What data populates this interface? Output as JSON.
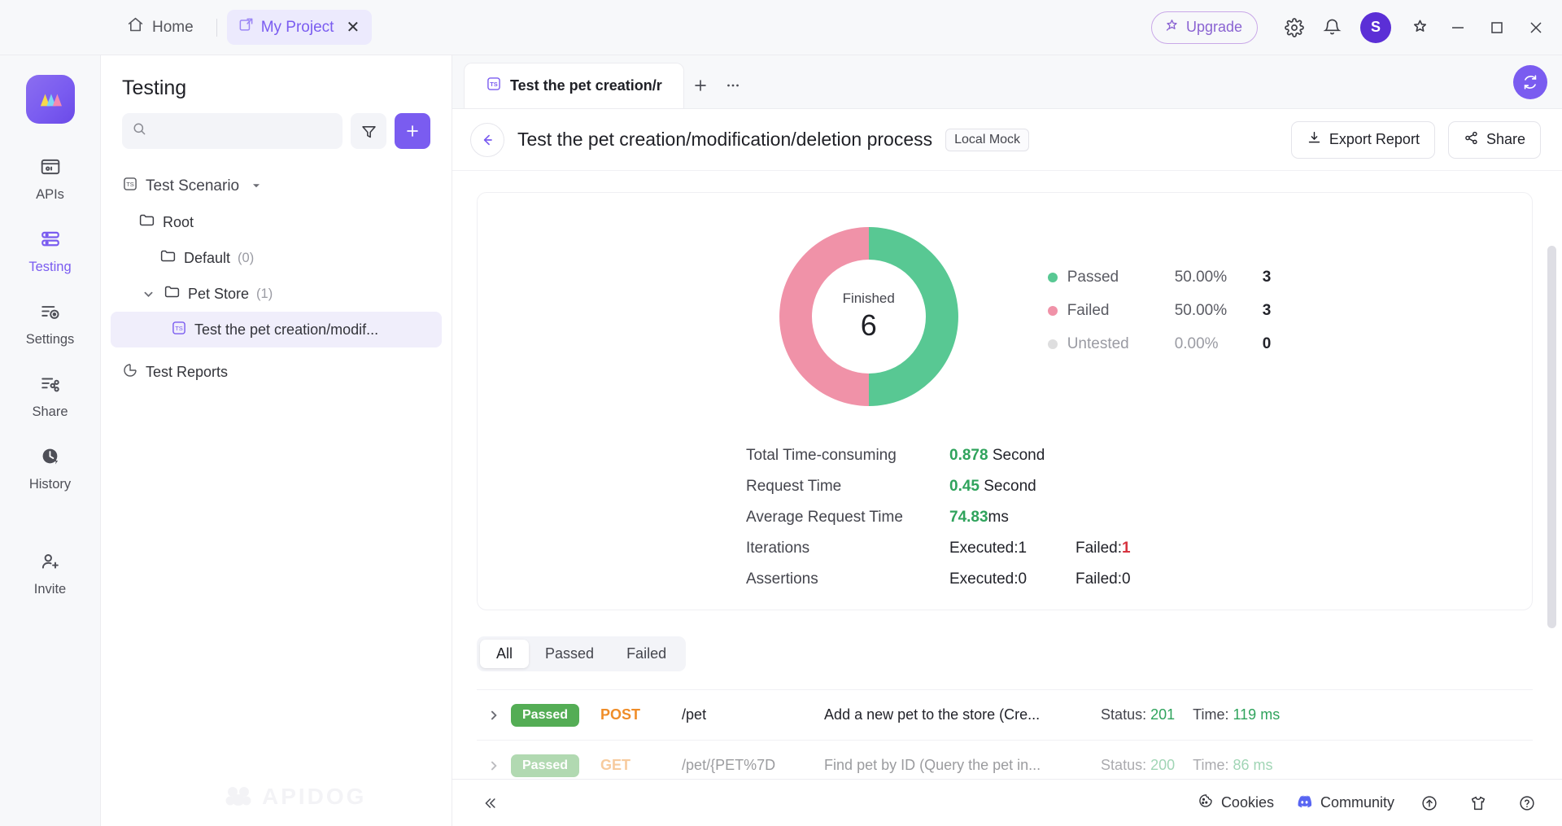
{
  "titlebar": {
    "home_label": "Home",
    "project_tab_label": "My Project",
    "project_tab_close": "✕",
    "upgrade_label": "Upgrade",
    "avatar_initial": "S"
  },
  "rail": {
    "items": [
      {
        "label": "APIs",
        "icon": "apis-icon"
      },
      {
        "label": "Testing",
        "icon": "testing-icon"
      },
      {
        "label": "Settings",
        "icon": "settings-icon"
      },
      {
        "label": "Share",
        "icon": "share-icon"
      },
      {
        "label": "History",
        "icon": "history-icon"
      },
      {
        "label": "Invite",
        "icon": "invite-icon"
      }
    ]
  },
  "tree": {
    "title": "Testing",
    "search_placeholder": "",
    "search_value": "",
    "scenario_label": "Test Scenario",
    "nodes": [
      {
        "label": "Root",
        "count": ""
      },
      {
        "label": "Default",
        "count": "(0)"
      },
      {
        "label": "Pet Store",
        "count": "(1)"
      },
      {
        "label": "Test the pet creation/modif..."
      }
    ],
    "reports_label": "Test Reports",
    "watermark": "APIDOG"
  },
  "main": {
    "file_tab_label": "Test the pet creation/r",
    "subtitle": "Test the pet creation/modification/deletion process",
    "mock_badge": "Local Mock",
    "export_label": "Export Report",
    "share_label": "Share"
  },
  "chart_data": {
    "type": "pie",
    "title": "Finished",
    "center_label": "Finished",
    "center_value": "6",
    "total": 6,
    "categories": [
      "Passed",
      "Failed",
      "Untested"
    ],
    "values": [
      3,
      3,
      0
    ],
    "percents": [
      "50.00%",
      "50.00%",
      "0.00%"
    ],
    "counts": [
      "3",
      "3",
      "0"
    ],
    "colors": [
      "#58c893",
      "#f092a8",
      "#dededf"
    ],
    "legend_position": "right",
    "donut": true
  },
  "stats": [
    {
      "label": "Total Time-consuming",
      "value": "0.878",
      "unit": " Second",
      "highlight": "green"
    },
    {
      "label": "Request Time",
      "value": "0.45",
      "unit": " Second",
      "highlight": "green"
    },
    {
      "label": "Average Request Time",
      "value": "74.83",
      "unit": "ms",
      "highlight": "green"
    },
    {
      "label": "Iterations",
      "executed": "Executed:1",
      "failed_prefix": "Failed:",
      "failed_value": "1",
      "failed_red": true
    },
    {
      "label": "Assertions",
      "executed": "Executed:0",
      "failed_prefix": "Failed:",
      "failed_value": "0",
      "failed_red": false
    }
  ],
  "filters": {
    "tabs": [
      "All",
      "Passed",
      "Failed"
    ],
    "active": "All"
  },
  "results": [
    {
      "status": "Passed",
      "method": "POST",
      "path": "/pet",
      "name": "Add a new pet to the store (Cre...",
      "status_label": "Status:",
      "status_code": "201",
      "time_label": "Time:",
      "time_value": "119 ms"
    },
    {
      "status": "Passed",
      "method": "GET",
      "path": "/pet/{PET%7D",
      "name": "Find pet by ID (Query the pet in...",
      "status_label": "Status:",
      "status_code": "200",
      "time_label": "Time:",
      "time_value": "86 ms"
    }
  ],
  "bottombar": {
    "cookies_label": "Cookies",
    "community_label": "Community"
  }
}
